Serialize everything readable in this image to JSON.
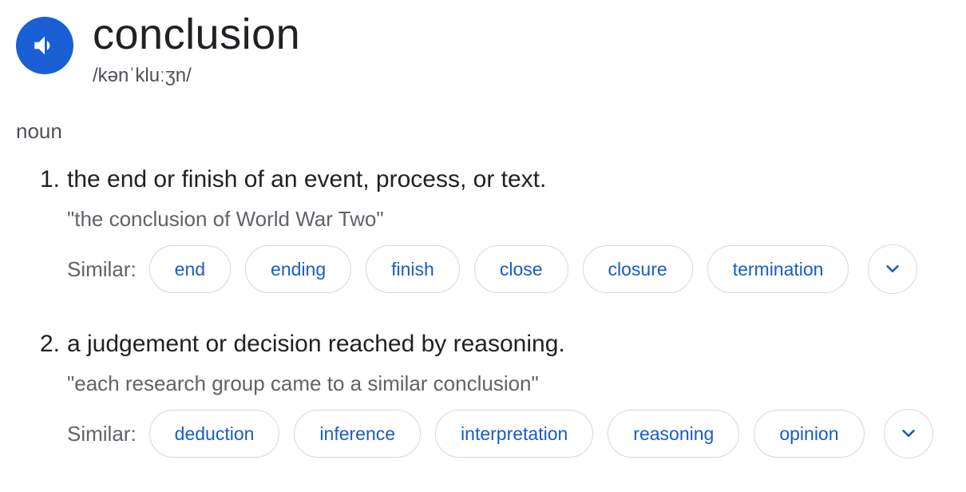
{
  "entry": {
    "word": "conclusion",
    "phonetic": "/kənˈkluːʒn/",
    "part_of_speech": "noun"
  },
  "senses": [
    {
      "number": "1.",
      "definition": "the end or finish of an event, process, or text.",
      "example": "\"the conclusion of World War Two\"",
      "similar_label": "Similar:",
      "similar": [
        "end",
        "ending",
        "finish",
        "close",
        "closure",
        "termination"
      ]
    },
    {
      "number": "2.",
      "definition": "a judgement or decision reached by reasoning.",
      "example": "\"each research group came to a similar conclusion\"",
      "similar_label": "Similar:",
      "similar": [
        "deduction",
        "inference",
        "interpretation",
        "reasoning",
        "opinion"
      ]
    }
  ],
  "icons": {
    "speaker": "speaker-icon",
    "expand": "chevron-down-icon"
  },
  "colors": {
    "speaker_bg": "#1a5fd3",
    "chip_text": "#1a5bc8",
    "chip_border": "#d6d8dc"
  }
}
